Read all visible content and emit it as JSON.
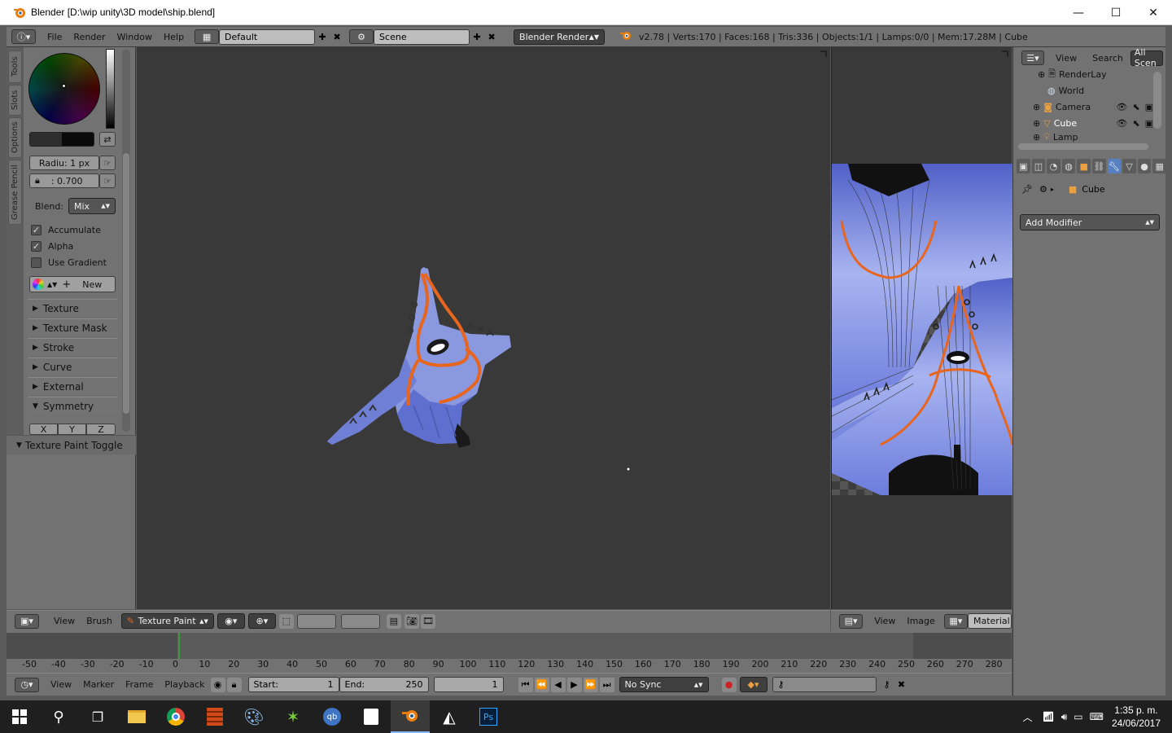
{
  "window": {
    "title": "Blender [D:\\wip unity\\3D model\\ship.blend]",
    "minimize": "—",
    "maximize": "☐",
    "close": "✕"
  },
  "topbar": {
    "menus": [
      "File",
      "Render",
      "Window",
      "Help"
    ],
    "layout_name": "Default",
    "scene_name": "Scene",
    "engine": "Blender Render",
    "status": "v2.78 | Verts:170 | Faces:168 | Tris:336 | Objects:1/1 | Lamps:0/0 | Mem:17.28M | Cube"
  },
  "tool_tabs": [
    "Tools",
    "Slots",
    "Options",
    "Grease Pencil"
  ],
  "brush": {
    "radius_label": "Radiu: 1 px",
    "strength_label": ": 0.700",
    "blend_label": "Blend:",
    "blend_value": "Mix",
    "accumulate": "Accumulate",
    "alpha": "Alpha",
    "use_gradient": "Use Gradient",
    "new_label": "New"
  },
  "sections": [
    "Texture",
    "Texture Mask",
    "Stroke",
    "Curve",
    "External",
    "Symmetry"
  ],
  "symmetry_axes": [
    "X",
    "Y",
    "Z"
  ],
  "texture_paint_toggle": "Texture Paint Toggle",
  "viewport_header": {
    "view": "View",
    "brush": "Brush",
    "mode": "Texture Paint"
  },
  "uv_header": {
    "view": "View",
    "image": "Image",
    "material": "Material"
  },
  "outliner": {
    "view": "View",
    "search": "Search",
    "scenes": "All Scen",
    "items": [
      "RenderLay",
      "World",
      "Camera",
      "Cube",
      "Lamp"
    ]
  },
  "properties": {
    "object": "Cube",
    "add_modifier": "Add Modifier"
  },
  "timeline": {
    "ticks": [
      "-50",
      "-40",
      "-30",
      "-20",
      "-10",
      "0",
      "10",
      "20",
      "30",
      "40",
      "50",
      "60",
      "70",
      "80",
      "90",
      "100",
      "110",
      "120",
      "130",
      "140",
      "150",
      "160",
      "170",
      "180",
      "190",
      "200",
      "210",
      "220",
      "230",
      "240",
      "250",
      "260",
      "270",
      "280"
    ],
    "menus": [
      "View",
      "Marker",
      "Frame",
      "Playback"
    ],
    "start_label": "Start:",
    "start_value": "1",
    "end_label": "End:",
    "end_value": "250",
    "current": "1",
    "sync": "No Sync"
  },
  "taskbar": {
    "time": "1:35 p. m.",
    "date": "24/06/2017"
  },
  "colors": {
    "ship_blue": "#7f8fe0",
    "ship_orange": "#e8651e",
    "panel": "#727272",
    "viewport": "#393939"
  }
}
